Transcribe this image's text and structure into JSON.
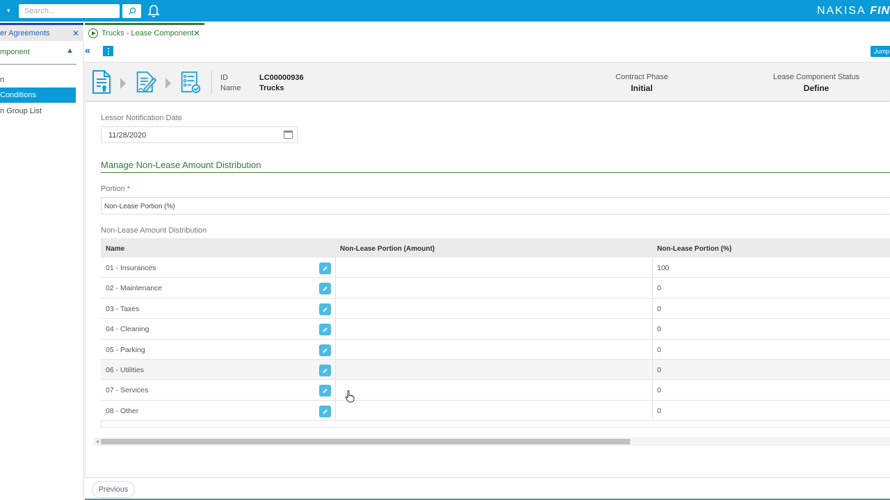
{
  "topbar": {
    "scope_caret": "▾",
    "search_placeholder": "Search...",
    "brand_left": "NAKISA",
    "brand_right": "FIN"
  },
  "tabs": [
    {
      "label": "er Agreements",
      "close": "✕",
      "active": false
    },
    {
      "label": "Trucks - Lease Component",
      "close": "✕",
      "active": true
    }
  ],
  "sidebar": {
    "header": "mponent",
    "header_chevron": "▲",
    "items": [
      {
        "label": "n",
        "active": false
      },
      {
        "label": " Conditions",
        "active": true
      },
      {
        "label": "n Group List",
        "active": false
      }
    ]
  },
  "actions": {
    "collapse": "«",
    "jump_label": "Jump"
  },
  "header": {
    "id_label": "ID",
    "id_value": "LC00000936",
    "name_label": "Name",
    "name_value": "Trucks",
    "phase_label": "Contract Phase",
    "phase_value": "Initial",
    "status_label": "Lease Component Status",
    "status_value": "Define"
  },
  "form": {
    "lessor_notification_label": "Lessor Notification Date",
    "lessor_notification_value": "11/28/2020",
    "section_title": "Manage Non-Lease Amount Distribution",
    "portion_label": "Portion",
    "portion_required": "*",
    "portion_value": "Non-Lease Portion (%)",
    "table_label": "Non-Lease Amount Distribution"
  },
  "table": {
    "columns": [
      "Name",
      "Non-Lease Portion (Amount)",
      "Non-Lease Portion (%)"
    ],
    "rows": [
      {
        "name": "01 - Insurances",
        "amount": "",
        "pct": "100"
      },
      {
        "name": "02 - Maintenance",
        "amount": "",
        "pct": "0"
      },
      {
        "name": "03 - Taxes",
        "amount": "",
        "pct": "0"
      },
      {
        "name": "04 - Cleaning",
        "amount": "",
        "pct": "0"
      },
      {
        "name": "05 - Parking",
        "amount": "",
        "pct": "0"
      },
      {
        "name": "06 - Utilities",
        "amount": "",
        "pct": "0"
      },
      {
        "name": "07 - Services",
        "amount": "",
        "pct": "0"
      },
      {
        "name": "08 - Other",
        "amount": "",
        "pct": "0"
      }
    ]
  },
  "footer": {
    "previous_label": "Previous"
  },
  "colors": {
    "topbar": "#0a9bd8",
    "accent_green": "#2e7d32",
    "edit_button": "#4fbbe0"
  }
}
